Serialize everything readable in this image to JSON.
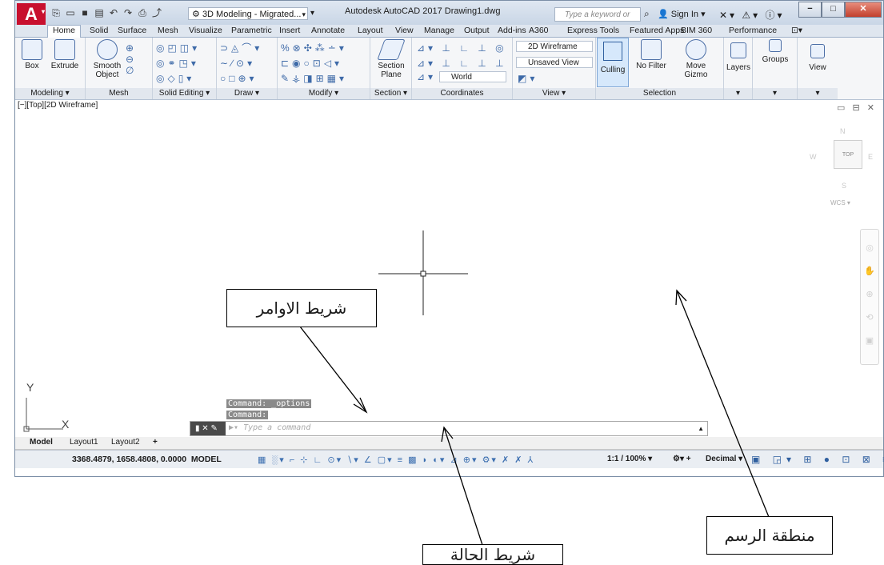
{
  "titlebar": {
    "app_letter": "A",
    "workspace": "3D Modeling - Migrated...",
    "title": "Autodesk AutoCAD 2017    Drawing1.dwg",
    "search_placeholder": "Type a keyword or phrase",
    "sign_in": "Sign In"
  },
  "tabs": [
    "Home",
    "Solid",
    "Surface",
    "Mesh",
    "Visualize",
    "Parametric",
    "Insert",
    "Annotate",
    "Layout",
    "View",
    "Manage",
    "Output",
    "Add-ins",
    "A360",
    "Express Tools",
    "Featured Apps",
    "BIM 360",
    "Performance"
  ],
  "ribbon": {
    "box": "Box",
    "extrude": "Extrude",
    "smooth_object": "Smooth Object",
    "section_plane": "Section Plane",
    "visual_style": "2D Wireframe",
    "saved_view": "Unsaved View",
    "ucs": "World",
    "culling": "Culling",
    "no_filter": "No Filter",
    "move_gizmo": "Move Gizmo",
    "layers": "Layers",
    "groups": "Groups",
    "view": "View",
    "panels": {
      "modeling": "Modeling ▾",
      "mesh": "Mesh",
      "solid_editing": "Solid Editing ▾",
      "draw": "Draw ▾",
      "modify": "Modify ▾",
      "section": "Section ▾",
      "coordinates": "Coordinates",
      "view": "View ▾",
      "selection": "Selection"
    }
  },
  "canvas": {
    "viewport_label": "[−][Top][2D Wireframe]",
    "viewcube_top": "TOP",
    "compass_n": "N",
    "compass_s": "S",
    "compass_e": "E",
    "compass_w": "W",
    "wcs": "WCS",
    "ucs_x": "X",
    "ucs_y": "Y"
  },
  "command": {
    "history_1": "Command: _options",
    "history_2": "Command:",
    "placeholder": "Type a command"
  },
  "layout_tabs": [
    "Model",
    "Layout1",
    "Layout2",
    "+"
  ],
  "status": {
    "coordinates": "3368.4879, 1658.4808, 0.0000",
    "model": "MODEL",
    "scale": "1:1 / 100% ▾",
    "units": "Decimal"
  },
  "callouts": {
    "command_bar": "شريط الاوامر",
    "status_bar": "شريط الحالة",
    "drawing_area": "منطقة الرسم"
  }
}
